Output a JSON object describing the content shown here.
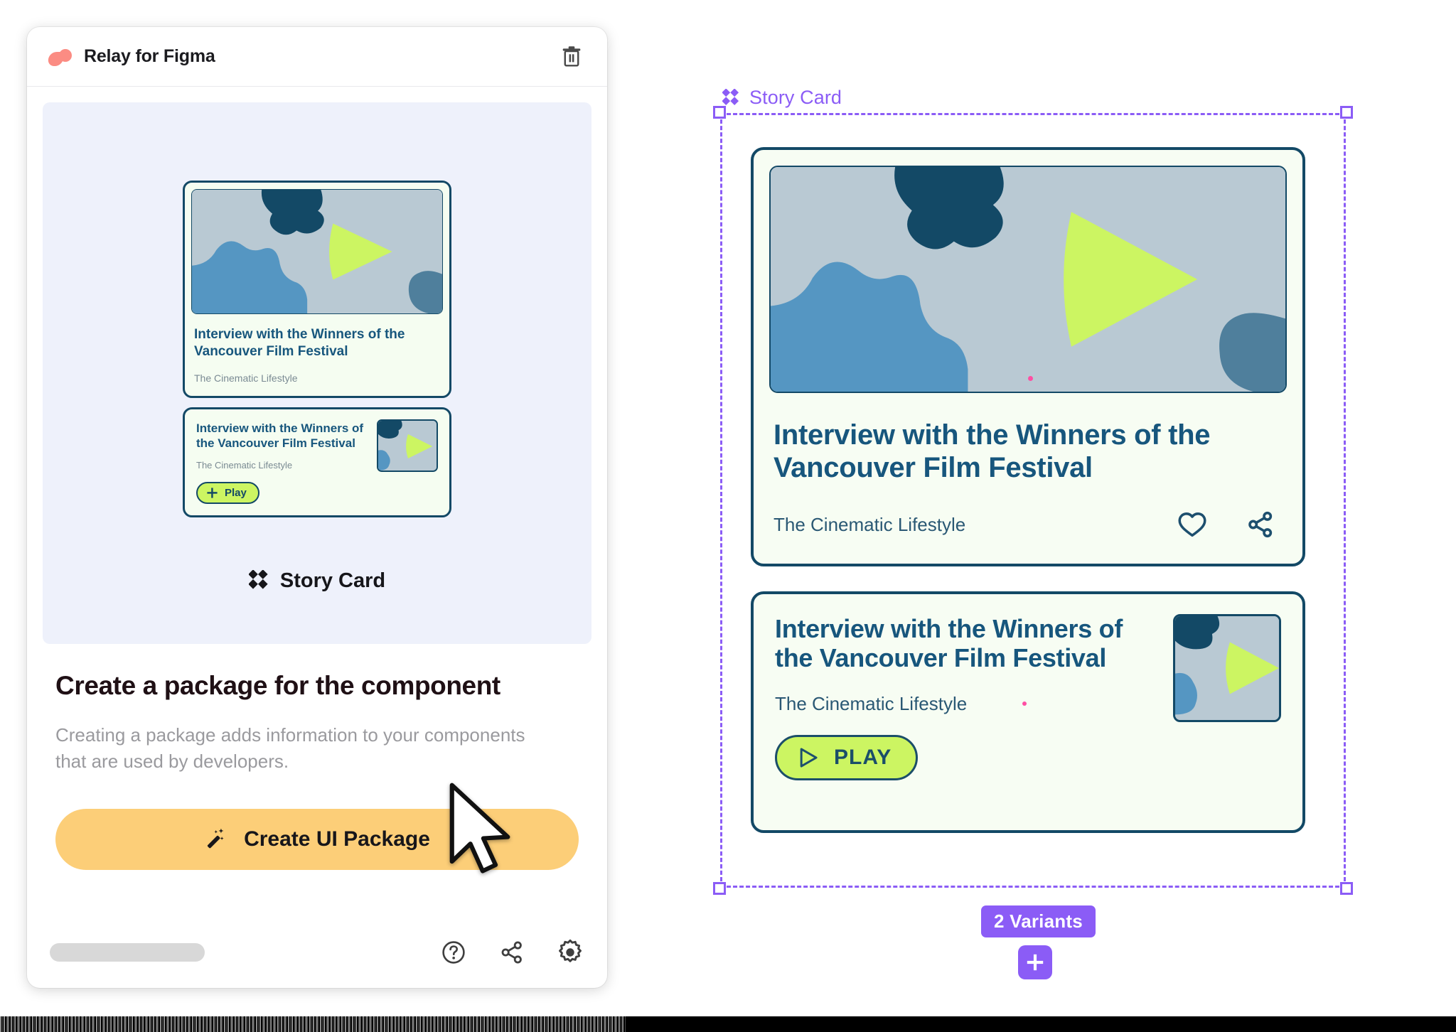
{
  "plugin": {
    "title": "Relay for Figma",
    "logo_color": "#FB8C83",
    "delete_icon": "trash-icon",
    "headline": "Create a package for the component",
    "subcopy": "Creating a package adds information to your components that are used by developers.",
    "cta_label": "Create UI Package",
    "cta_icon": "magic-wand-icon",
    "cta_color": "#FCCE78",
    "stage_label": "Story Card",
    "stage_icon": "figma-component-icon",
    "footer": {
      "help_icon": "help-circle-icon",
      "share_icon": "share-icon",
      "settings_icon": "gear-icon"
    }
  },
  "preview": {
    "card_a": {
      "title": "Interview with the Winners of the Vancouver Film Festival",
      "subtitle": "The Cinematic Lifestyle"
    },
    "card_b": {
      "title": "Interview with the Winners of the Vancouver Film Festival",
      "subtitle": "The Cinematic Lifestyle",
      "play_label": "Play",
      "play_icon": "plus-icon"
    }
  },
  "canvas": {
    "component_label": "Story Card",
    "component_icon": "figma-component-icon",
    "selection_color": "#8B5CF6",
    "variants_badge": "2 Variants",
    "add_variant_icon": "plus-icon",
    "card_one": {
      "title": "Interview with the Winners of the Vancouver Film Festival",
      "subtitle": "The Cinematic Lifestyle",
      "like_icon": "heart-icon",
      "share_icon": "share-icon"
    },
    "card_two": {
      "title": "Interview with the Winners of the Vancouver Film Festival",
      "subtitle": "The Cinematic Lifestyle",
      "play_label": "PLAY",
      "play_icon": "play-triangle-icon"
    }
  },
  "colors": {
    "card_bg": "#F7FDF3",
    "card_border": "#134966",
    "title_text": "#17567D",
    "lime": "#CCF562",
    "thumb_sky": "#B9C9D3",
    "thumb_navy": "#134966",
    "thumb_blue": "#5596C2",
    "stage_bg": "#EEF1FB"
  }
}
